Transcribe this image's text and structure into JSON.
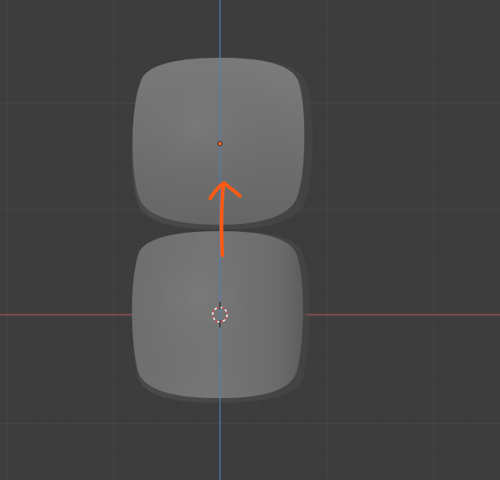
{
  "viewport": {
    "background": "#3d3d3d",
    "grid_minor_color": "#3a3a3a",
    "grid_major_color": "#474747"
  },
  "axes": {
    "x_axis_color": "#c95a5a",
    "y_axis_color": "#4f7fc2"
  },
  "objects": [
    {
      "name": "upper-rounded-cube",
      "selected": false
    },
    {
      "name": "lower-rounded-cube",
      "selected": false
    }
  ],
  "annotation": {
    "color": "#ff5a14",
    "icon": "arrow-up-icon"
  },
  "markers": {
    "origin_color": "#ff6a2a",
    "cursor_color": "#ffffff",
    "cursor_icon": "3d-cursor-icon"
  }
}
